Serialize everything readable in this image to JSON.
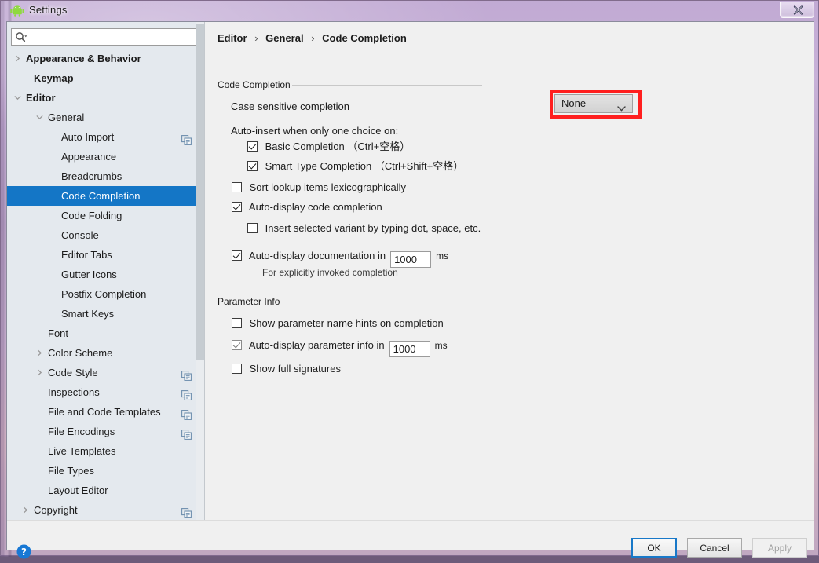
{
  "window": {
    "title": "Settings",
    "app_icon": "android-robot-icon",
    "close_label": "✖"
  },
  "search": {
    "placeholder": "",
    "value": "",
    "icon": "search-icon"
  },
  "sidebar": {
    "items": [
      {
        "label": "Appearance & Behavior",
        "indent": 24,
        "bold": true,
        "arrow": "right",
        "selected": false,
        "copy": false
      },
      {
        "label": "Keymap",
        "indent": 34,
        "bold": true,
        "arrow": "none",
        "selected": false,
        "copy": false
      },
      {
        "label": "Editor",
        "indent": 24,
        "bold": true,
        "arrow": "down",
        "selected": false,
        "copy": false
      },
      {
        "label": "General",
        "indent": 52,
        "bold": false,
        "arrow": "down",
        "selected": false,
        "copy": false
      },
      {
        "label": "Auto Import",
        "indent": 69,
        "bold": false,
        "arrow": "none",
        "selected": false,
        "copy": true
      },
      {
        "label": "Appearance",
        "indent": 69,
        "bold": false,
        "arrow": "none",
        "selected": false,
        "copy": false
      },
      {
        "label": "Breadcrumbs",
        "indent": 69,
        "bold": false,
        "arrow": "none",
        "selected": false,
        "copy": false
      },
      {
        "label": "Code Completion",
        "indent": 69,
        "bold": false,
        "arrow": "none",
        "selected": true,
        "copy": false
      },
      {
        "label": "Code Folding",
        "indent": 69,
        "bold": false,
        "arrow": "none",
        "selected": false,
        "copy": false
      },
      {
        "label": "Console",
        "indent": 69,
        "bold": false,
        "arrow": "none",
        "selected": false,
        "copy": false
      },
      {
        "label": "Editor Tabs",
        "indent": 69,
        "bold": false,
        "arrow": "none",
        "selected": false,
        "copy": false
      },
      {
        "label": "Gutter Icons",
        "indent": 69,
        "bold": false,
        "arrow": "none",
        "selected": false,
        "copy": false
      },
      {
        "label": "Postfix Completion",
        "indent": 69,
        "bold": false,
        "arrow": "none",
        "selected": false,
        "copy": false
      },
      {
        "label": "Smart Keys",
        "indent": 69,
        "bold": false,
        "arrow": "none",
        "selected": false,
        "copy": false
      },
      {
        "label": "Font",
        "indent": 52,
        "bold": false,
        "arrow": "none",
        "selected": false,
        "copy": false
      },
      {
        "label": "Color Scheme",
        "indent": 52,
        "bold": false,
        "arrow": "right",
        "selected": false,
        "copy": false
      },
      {
        "label": "Code Style",
        "indent": 52,
        "bold": false,
        "arrow": "right",
        "selected": false,
        "copy": true
      },
      {
        "label": "Inspections",
        "indent": 52,
        "bold": false,
        "arrow": "none",
        "selected": false,
        "copy": true
      },
      {
        "label": "File and Code Templates",
        "indent": 52,
        "bold": false,
        "arrow": "none",
        "selected": false,
        "copy": true
      },
      {
        "label": "File Encodings",
        "indent": 52,
        "bold": false,
        "arrow": "none",
        "selected": false,
        "copy": true
      },
      {
        "label": "Live Templates",
        "indent": 52,
        "bold": false,
        "arrow": "none",
        "selected": false,
        "copy": false
      },
      {
        "label": "File Types",
        "indent": 52,
        "bold": false,
        "arrow": "none",
        "selected": false,
        "copy": false
      },
      {
        "label": "Layout Editor",
        "indent": 52,
        "bold": false,
        "arrow": "none",
        "selected": false,
        "copy": false
      },
      {
        "label": "Copyright",
        "indent": 34,
        "bold": false,
        "arrow": "right",
        "selected": false,
        "copy": true
      }
    ]
  },
  "breadcrumb": {
    "part1": "Editor",
    "sep1": "›",
    "part2": "General",
    "sep2": "›",
    "part3": "Code Completion"
  },
  "main": {
    "group_completion": "Code Completion",
    "group_parameter": "Parameter Info",
    "case_sensitive_label": "Case sensitive completion",
    "case_sensitive_value": "None",
    "auto_insert_label": "Auto-insert when only one choice on:",
    "basic_completion": "Basic Completion （Ctrl+空格）",
    "smart_type_completion": "Smart Type Completion （Ctrl+Shift+空格）",
    "sort_lookup": "Sort lookup items lexicographically",
    "auto_display_code": "Auto-display code completion",
    "insert_selected_variant": "Insert selected variant by typing dot, space, etc.",
    "auto_display_doc": "Auto-display documentation in",
    "auto_display_doc_value": "1000",
    "auto_display_doc_unit": "ms",
    "doc_note": "For explicitly invoked completion",
    "show_param_hints": "Show parameter name hints on completion",
    "auto_display_param": "Auto-display parameter info in",
    "auto_display_param_value": "1000",
    "auto_display_param_unit": "ms",
    "show_full_signatures": "Show full signatures"
  },
  "footer": {
    "help_icon": "help-question-icon",
    "ok": "OK",
    "cancel": "Cancel",
    "apply": "Apply"
  },
  "colors": {
    "selection_blue": "#1476c6",
    "highlight_red": "#ff1f1f",
    "focus_blue": "#1878c8",
    "sidebar_bg": "#e4e9ee",
    "content_bg": "#f0f0f0"
  }
}
